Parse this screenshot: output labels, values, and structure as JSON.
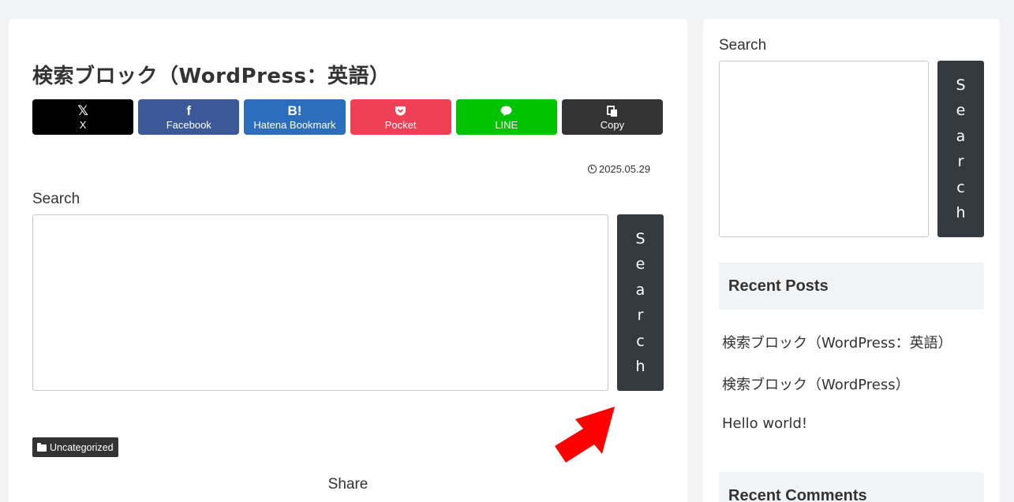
{
  "post": {
    "title": "検索ブロック（WordPress：英語）",
    "date": "2025.05.29",
    "category": "Uncategorized",
    "share_label": "Share"
  },
  "share_buttons": [
    {
      "label": "X",
      "icon": "x-logo-icon",
      "glyph": "𝕏",
      "color": "#000000"
    },
    {
      "label": "Facebook",
      "icon": "facebook-icon",
      "glyph": "f",
      "color": "#3b5998"
    },
    {
      "label": "Hatena Bookmark",
      "icon": "hatena-icon",
      "glyph": "B!",
      "color": "#2c6ebd"
    },
    {
      "label": "Pocket",
      "icon": "pocket-icon",
      "glyph": "◐",
      "color": "#ef4056"
    },
    {
      "label": "LINE",
      "icon": "line-icon",
      "glyph": "●",
      "color": "#00c300"
    },
    {
      "label": "Copy",
      "icon": "copy-icon",
      "glyph": "❐",
      "color": "#333333"
    }
  ],
  "main_search": {
    "label": "Search",
    "placeholder": "",
    "button_letters": [
      "S",
      "e",
      "a",
      "r",
      "c",
      "h"
    ]
  },
  "sidebar": {
    "search": {
      "label": "Search",
      "placeholder": "",
      "button_letters": [
        "S",
        "e",
        "a",
        "r",
        "c",
        "h"
      ]
    },
    "recent_posts": {
      "title": "Recent Posts",
      "items": [
        "検索ブロック（WordPress：英語）",
        "検索ブロック（WordPress）",
        "Hello world!"
      ]
    },
    "recent_comments": {
      "title": "Recent Comments"
    }
  },
  "colors": {
    "annotation_arrow": "#ff0000",
    "search_button": "#343a40",
    "page_background": "#f2f3f5"
  }
}
